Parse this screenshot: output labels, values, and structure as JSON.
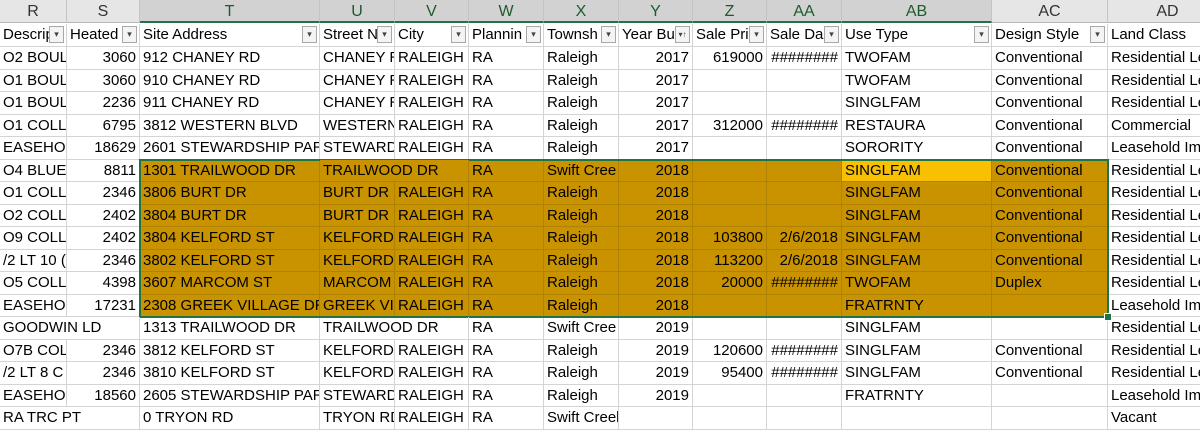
{
  "columns": [
    "R",
    "S",
    "T",
    "U",
    "V",
    "W",
    "X",
    "Y",
    "Z",
    "AA",
    "AB",
    "AC",
    "AD"
  ],
  "headers": [
    "Descrip",
    "Heated",
    "Site Address",
    "Street N",
    "City",
    "Plannin",
    "Townsh",
    "Year Bu",
    "Sale Pri",
    "Sale Da",
    "Use Type",
    "Design Style",
    "Land Class"
  ],
  "rows": [
    [
      "O2 BOUL",
      "3060",
      "912 CHANEY RD",
      "CHANEY R",
      "RALEIGH",
      "RA",
      "Raleigh",
      "2017",
      "619000",
      "########",
      "TWOFAM",
      "Conventional",
      "Residential Le"
    ],
    [
      "O1 BOUL",
      "3060",
      "910 CHANEY RD",
      "CHANEY R",
      "RALEIGH",
      "RA",
      "Raleigh",
      "2017",
      "",
      "",
      "TWOFAM",
      "Conventional",
      "Residential Le"
    ],
    [
      "O1 BOUL",
      "2236",
      "911 CHANEY RD",
      "CHANEY R",
      "RALEIGH",
      "RA",
      "Raleigh",
      "2017",
      "",
      "",
      "SINGLFAM",
      "Conventional",
      "Residential Le"
    ],
    [
      "O1 COLLE",
      "6795",
      "3812 WESTERN BLVD",
      "WESTERN",
      "RALEIGH",
      "RA",
      "Raleigh",
      "2017",
      "312000",
      "########",
      "RESTAURA",
      "Conventional",
      "Commercial"
    ],
    [
      "EASEHOL",
      "18629",
      "2601 STEWARDSHIP PARK",
      "STEWARDS",
      "RALEIGH",
      "RA",
      "Raleigh",
      "2017",
      "",
      "",
      "SORORITY",
      "Conventional",
      "Leasehold Im"
    ],
    [
      "O4 BLUEI",
      "8811",
      "1301 TRAILWOOD DR",
      "TRAILWOOD DR",
      "",
      "RA",
      "Swift Cree",
      "2018",
      "",
      "",
      "SINGLFAM",
      "Conventional",
      "Residential Le"
    ],
    [
      "O1 COLLE",
      "2346",
      "3806 BURT DR",
      "BURT DR",
      "RALEIGH",
      "RA",
      "Raleigh",
      "2018",
      "",
      "",
      "SINGLFAM",
      "Conventional",
      "Residential Le"
    ],
    [
      "O2 COLLE",
      "2402",
      "3804 BURT DR",
      "BURT DR",
      "RALEIGH",
      "RA",
      "Raleigh",
      "2018",
      "",
      "",
      "SINGLFAM",
      "Conventional",
      "Residential Le"
    ],
    [
      "O9 COLLE",
      "2402",
      "3804 KELFORD ST",
      "KELFORD S",
      "RALEIGH",
      "RA",
      "Raleigh",
      "2018",
      "103800",
      "2/6/2018",
      "SINGLFAM",
      "Conventional",
      "Residential Le"
    ],
    [
      "/2 LT 10 (",
      "2346",
      "3802 KELFORD ST",
      "KELFORD S",
      "RALEIGH",
      "RA",
      "Raleigh",
      "2018",
      "113200",
      "2/6/2018",
      "SINGLFAM",
      "Conventional",
      "Residential Le"
    ],
    [
      "O5 COLLE",
      "4398",
      "3607 MARCOM ST",
      "MARCOM",
      "RALEIGH",
      "RA",
      "Raleigh",
      "2018",
      "20000",
      "########",
      "TWOFAM",
      "Duplex",
      "Residential Le"
    ],
    [
      "EASEHOL",
      "17231",
      "2308 GREEK VILLAGE DR",
      "GREEK VIL",
      "RALEIGH",
      "RA",
      "Raleigh",
      "2018",
      "",
      "",
      "FRATRNTY",
      "",
      "Leasehold Im"
    ],
    [
      "GOODWIN LD",
      "",
      "1313 TRAILWOOD DR",
      "TRAILWOOD DR",
      "",
      "RA",
      "Swift Cree",
      "2019",
      "",
      "",
      "SINGLFAM",
      "",
      "Residential Le"
    ],
    [
      "O7B COLI",
      "2346",
      "3812 KELFORD ST",
      "KELFORD S",
      "RALEIGH",
      "RA",
      "Raleigh",
      "2019",
      "120600",
      "########",
      "SINGLFAM",
      "Conventional",
      "Residential Le"
    ],
    [
      "/2 LT 8 C",
      "2346",
      "3810 KELFORD ST",
      "KELFORD S",
      "RALEIGH",
      "RA",
      "Raleigh",
      "2019",
      "95400",
      "########",
      "SINGLFAM",
      "Conventional",
      "Residential Le"
    ],
    [
      "EASEHOL",
      "18560",
      "2605 STEWARDSHIP PARK",
      "STEWARDS",
      "RALEIGH",
      "RA",
      "Raleigh",
      "2019",
      "",
      "",
      "FRATRNTY",
      "",
      "Leasehold Im"
    ],
    [
      "RA TRC PT",
      "",
      "0 TRYON RD",
      "TRYON RD",
      "RALEIGH",
      "RA",
      "Swift Creek",
      "",
      "",
      "",
      "",
      "",
      "Vacant"
    ]
  ],
  "colors": {
    "highlight": "#c99300",
    "active_cell": "#f8c000",
    "selection_border": "#217346"
  },
  "icons": {
    "filter_button": "dropdown-arrow-icon",
    "sorted_filter_button": "sort-dropdown-icon"
  }
}
